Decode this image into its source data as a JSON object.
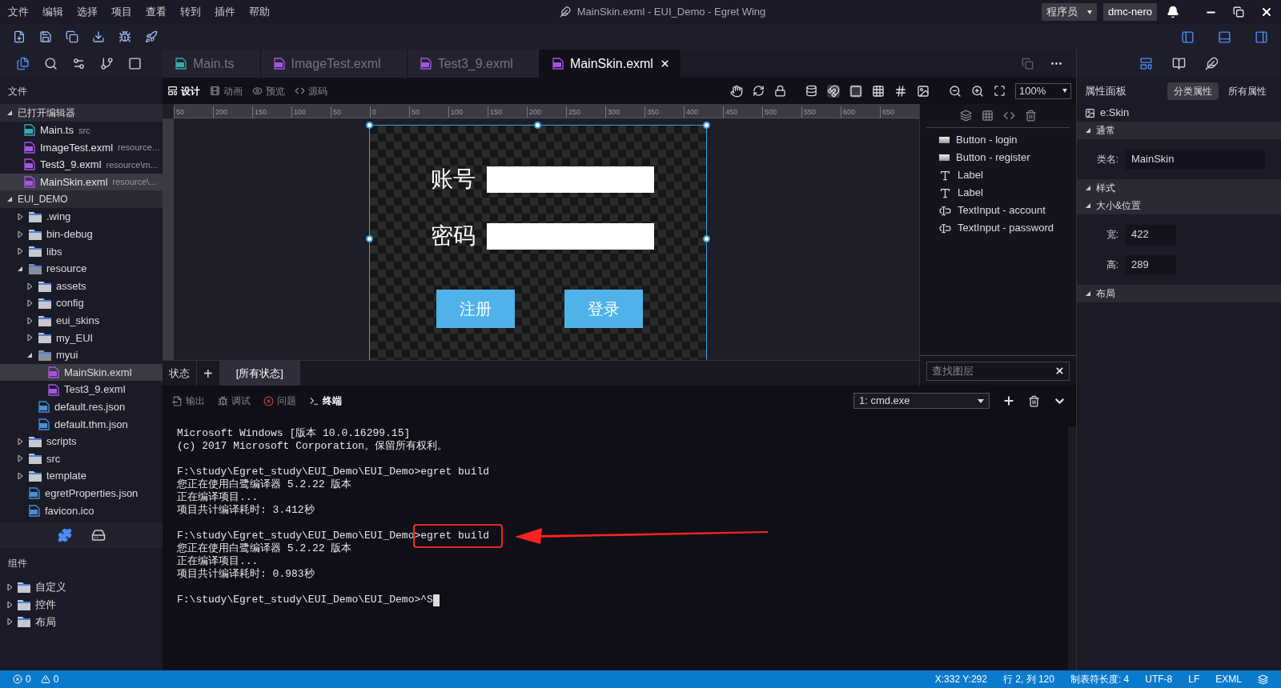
{
  "menu": [
    "文件",
    "编辑",
    "选择",
    "项目",
    "查看",
    "转到",
    "插件",
    "帮助"
  ],
  "window": {
    "title": "MainSkin.exml - EUI_Demo - Egret Wing"
  },
  "account": {
    "role": "程序员",
    "user": "dmc-nero"
  },
  "editor_tabs": [
    {
      "label": "Main.ts",
      "kind": "ts",
      "selected": false
    },
    {
      "label": "ImageTest.exml",
      "kind": "exml",
      "selected": false
    },
    {
      "label": "Test3_9.exml",
      "kind": "exml",
      "selected": false
    },
    {
      "label": "MainSkin.exml",
      "kind": "exml",
      "selected": true
    }
  ],
  "view_modes": [
    {
      "label": "设计",
      "selected": true
    },
    {
      "label": "动画",
      "selected": false
    },
    {
      "label": "预览",
      "selected": false
    },
    {
      "label": "源码",
      "selected": false
    }
  ],
  "zoom": "100%",
  "ruler_labels": [
    "50",
    "200",
    "150",
    "100",
    "50",
    "0",
    "50",
    "100",
    "150",
    "200",
    "250",
    "300",
    "350",
    "400",
    "450",
    "500",
    "550",
    "600",
    "650"
  ],
  "sidebar": {
    "title": "文件",
    "open_editors": {
      "title": "已打开编辑器",
      "expanded": true,
      "items": [
        {
          "name": "Main.ts",
          "path": "src",
          "kind": "ts",
          "selected": false
        },
        {
          "name": "ImageTest.exml",
          "path": "resource...",
          "kind": "exml",
          "selected": false
        },
        {
          "name": "Test3_9.exml",
          "path": "resource\\m...",
          "kind": "exml",
          "selected": false
        },
        {
          "name": "MainSkin.exml",
          "path": "resource\\...",
          "kind": "exml",
          "selected": true
        }
      ]
    },
    "project": {
      "title": "EUI_DEMO",
      "expanded": true,
      "items": [
        {
          "name": ".wing",
          "kind": "folder",
          "expanded": false,
          "selected": false
        },
        {
          "name": "bin-debug",
          "kind": "folder",
          "expanded": false,
          "selected": false
        },
        {
          "name": "libs",
          "kind": "folder",
          "expanded": false,
          "selected": false
        },
        {
          "name": "resource",
          "kind": "folder",
          "expanded": true,
          "selected": false,
          "children": [
            {
              "name": "assets",
              "kind": "folder",
              "expanded": false,
              "selected": false
            },
            {
              "name": "config",
              "kind": "folder",
              "expanded": false,
              "selected": false
            },
            {
              "name": "eui_skins",
              "kind": "folder",
              "expanded": false,
              "selected": false
            },
            {
              "name": "my_EUI",
              "kind": "folder",
              "expanded": false,
              "selected": false
            },
            {
              "name": "myui",
              "kind": "folder",
              "expanded": true,
              "selected": false,
              "children": [
                {
                  "name": "MainSkin.exml",
                  "kind": "exml",
                  "selected": true
                },
                {
                  "name": "Test3_9.exml",
                  "kind": "exml",
                  "selected": false
                }
              ]
            },
            {
              "name": "default.res.json",
              "kind": "json",
              "selected": false
            },
            {
              "name": "default.thm.json",
              "kind": "json",
              "selected": false
            }
          ]
        },
        {
          "name": "scripts",
          "kind": "folder",
          "expanded": false,
          "selected": false
        },
        {
          "name": "src",
          "kind": "folder",
          "expanded": false,
          "selected": false
        },
        {
          "name": "template",
          "kind": "folder",
          "expanded": false,
          "selected": false
        },
        {
          "name": "egretProperties.json",
          "kind": "json",
          "selected": false
        },
        {
          "name": "favicon.ico",
          "kind": "ico",
          "selected": false
        }
      ]
    },
    "components": {
      "title": "组件",
      "items": [
        {
          "name": "自定义",
          "expanded": false
        },
        {
          "name": "控件",
          "expanded": false
        },
        {
          "name": "布局",
          "expanded": false
        }
      ]
    }
  },
  "design": {
    "fields": [
      {
        "label": "账号"
      },
      {
        "label": "密码"
      }
    ],
    "buttons": [
      "注册",
      "登录"
    ]
  },
  "layers": {
    "items": [
      {
        "label": "Button - login",
        "kind": "button"
      },
      {
        "label": "Button - register",
        "kind": "button"
      },
      {
        "label": "Label",
        "kind": "label"
      },
      {
        "label": "Label",
        "kind": "label"
      },
      {
        "label": "TextInput - account",
        "kind": "input"
      },
      {
        "label": "TextInput - password",
        "kind": "input"
      }
    ],
    "search_placeholder": "查找图层"
  },
  "states": {
    "label": "状态",
    "add": "+",
    "tabs": [
      {
        "label": "[所有状态]",
        "selected": true
      }
    ]
  },
  "properties": {
    "title": "属性面板",
    "tabs": [
      {
        "label": "分类属性",
        "selected": true
      },
      {
        "label": "所有属性",
        "selected": false
      }
    ],
    "element": "e:Skin",
    "sections": [
      {
        "title": "通常",
        "expanded": true,
        "rows": [
          {
            "label": "类名:",
            "value": "MainSkin",
            "kind": "wide"
          }
        ]
      },
      {
        "title": "样式",
        "expanded": true
      },
      {
        "title": "大小&位置",
        "expanded": true,
        "rows": [
          {
            "label": "宽:",
            "value": "422",
            "kind": "narrow"
          },
          {
            "label": "高:",
            "value": "289",
            "kind": "narrow"
          }
        ]
      },
      {
        "title": "布局",
        "expanded": true
      }
    ]
  },
  "panel_tabs": [
    {
      "label": "输出",
      "selected": false
    },
    {
      "label": "调试",
      "selected": false
    },
    {
      "label": "问题",
      "selected": false
    },
    {
      "label": "终端",
      "selected": true
    }
  ],
  "terminal": {
    "shell": "1: cmd.exe",
    "lines": [
      {
        "kind": "text",
        "text": "Microsoft Windows [版本 10.0.16299.15]"
      },
      {
        "kind": "text",
        "text": "(c) 2017 Microsoft Corporation。保留所有权利。"
      },
      {
        "kind": "blank"
      },
      {
        "kind": "text",
        "text": "F:\\study\\Egret_study\\EUI_Demo\\EUI_Demo>egret build"
      },
      {
        "kind": "text",
        "text": "您正在使用白鹭编译器 5.2.22 版本"
      },
      {
        "kind": "text",
        "text": "正在编译项目..."
      },
      {
        "kind": "text",
        "text": "项目共计编译耗时: 3.412秒"
      },
      {
        "kind": "blank"
      },
      {
        "kind": "text",
        "text": "F:\\study\\Egret_study\\EUI_Demo\\EUI_Demo",
        "boxed": ">egret build"
      },
      {
        "kind": "text",
        "text": "您正在使用白鹭编译器 5.2.22 版本"
      },
      {
        "kind": "text",
        "text": "正在编译项目..."
      },
      {
        "kind": "text",
        "text": "项目共计编译耗时: 0.983秒"
      },
      {
        "kind": "blank"
      },
      {
        "kind": "text",
        "text": "F:\\study\\Egret_study\\EUI_Demo\\EUI_Demo>^S",
        "cursor": true
      }
    ]
  },
  "status_bar": {
    "errors": "0",
    "warnings": "0",
    "items": [
      "X:332 Y:292",
      "行 2, 列 120",
      "制表符长度: 4",
      "UTF-8",
      "LF",
      "EXML"
    ]
  }
}
